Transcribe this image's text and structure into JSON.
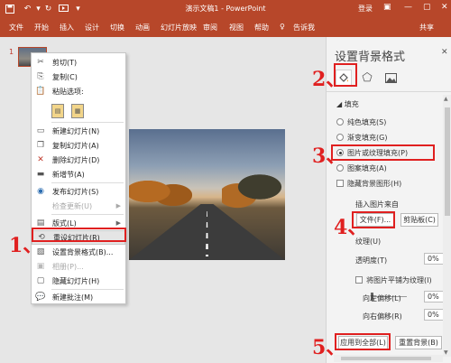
{
  "titlebar": {
    "title": "演示文稿1 - PowerPoint",
    "login_label": "登录",
    "icons": [
      "save-icon",
      "undo-icon",
      "redo-icon",
      "slideshow-icon",
      "customize-icon",
      "ribbon-display-icon",
      "minimize-icon",
      "maximize-icon",
      "close-icon"
    ],
    "accent_color": "#b7472a"
  },
  "ribbon": {
    "tabs": [
      "文件",
      "开始",
      "插入",
      "设计",
      "切换",
      "动画",
      "幻灯片放映",
      "审阅",
      "视图",
      "帮助"
    ],
    "tell_me": "告诉我",
    "share": "共享"
  },
  "thumbnails": {
    "slide_number": "1"
  },
  "context_menu": {
    "items": [
      {
        "label": "剪切(T)",
        "icon": "scissors-icon",
        "enabled": true
      },
      {
        "label": "复制(C)",
        "icon": "copy-icon",
        "enabled": true
      },
      {
        "label": "粘贴选项:",
        "icon": "clipboard-icon",
        "enabled": true
      },
      {
        "label": "新建幻灯片(N)",
        "icon": "new-slide-icon",
        "enabled": true
      },
      {
        "label": "复制幻灯片(A)",
        "icon": "duplicate-slide-icon",
        "enabled": true
      },
      {
        "label": "删除幻灯片(D)",
        "icon": "delete-slide-icon",
        "enabled": true
      },
      {
        "label": "新增节(A)",
        "icon": "add-section-icon",
        "enabled": true
      },
      {
        "label": "发布幻灯片(S)",
        "icon": "publish-icon",
        "enabled": true
      },
      {
        "label": "检查更新(U)",
        "icon": "",
        "enabled": false,
        "submenu": true
      },
      {
        "label": "版式(L)",
        "icon": "layout-icon",
        "enabled": true,
        "submenu": true
      },
      {
        "label": "重设幻灯片(R)",
        "icon": "reset-slide-icon",
        "enabled": true,
        "highlighted": true
      },
      {
        "label": "设置背景格式(B)...",
        "icon": "format-background-icon",
        "enabled": true
      },
      {
        "label": "相册(P)...",
        "icon": "photo-album-icon",
        "enabled": false
      },
      {
        "label": "隐藏幻灯片(H)",
        "icon": "hide-slide-icon",
        "enabled": true
      },
      {
        "label": "新建批注(M)",
        "icon": "new-comment-icon",
        "enabled": true
      }
    ]
  },
  "format_pane": {
    "title": "设置背景格式",
    "section": "填充",
    "fill_options": [
      {
        "label": "纯色填充(S)",
        "selected": false
      },
      {
        "label": "渐变填充(G)",
        "selected": false
      },
      {
        "label": "图片或纹理填充(P)",
        "selected": true
      },
      {
        "label": "图案填充(A)",
        "selected": false
      }
    ],
    "hide_graphics": "隐藏背景图形(H)",
    "insert_from": "插入图片来自",
    "file_button": "文件(F)...",
    "clipboard_button": "剪贴板(C)",
    "texture_label": "纹理(U)",
    "transparency_label": "透明度(T)",
    "transparency_value": "0%",
    "tile_label": "将图片平铺为纹理(I)",
    "offset_left_label": "向左偏移(L)",
    "offset_left_value": "0%",
    "offset_right_label": "向右偏移(R)",
    "offset_right_value": "0%",
    "apply_all_button": "应用到全部(L)",
    "reset_button": "重置背景(B)"
  },
  "annotations": {
    "color": "#e02020",
    "numbers": [
      "1、",
      "2、",
      "3、",
      "4、",
      "5、"
    ]
  }
}
